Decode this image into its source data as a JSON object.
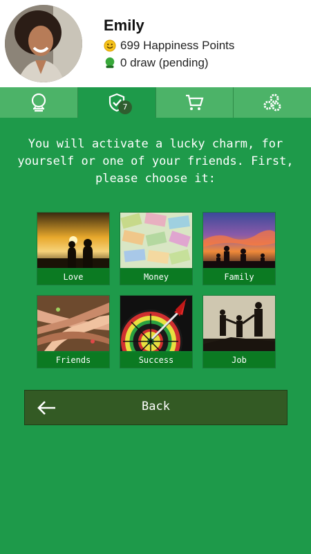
{
  "profile": {
    "name": "Emily",
    "points_text": "699 Happiness Points",
    "draw_text": "0 draw (pending)"
  },
  "tabs": [
    {
      "icon": "crystal-ball-icon",
      "active": false
    },
    {
      "icon": "shield-check-icon",
      "active": true,
      "badge": "7"
    },
    {
      "icon": "cart-icon",
      "active": false
    },
    {
      "icon": "gears-icon",
      "active": false
    }
  ],
  "instructions": {
    "line1": "You will activate a lucky charm, for",
    "line2": "yourself or one of your friends. First,",
    "line3": "please choose it:"
  },
  "charms": [
    {
      "label": "Love"
    },
    {
      "label": "Money"
    },
    {
      "label": "Family"
    },
    {
      "label": "Friends"
    },
    {
      "label": "Success"
    },
    {
      "label": "Job"
    }
  ],
  "back_button": {
    "label": "Back"
  },
  "colors": {
    "primary": "#1e9a4a",
    "tab_inactive": "#4cb368",
    "button": "#335a24",
    "label_bar": "#0b7a22"
  }
}
